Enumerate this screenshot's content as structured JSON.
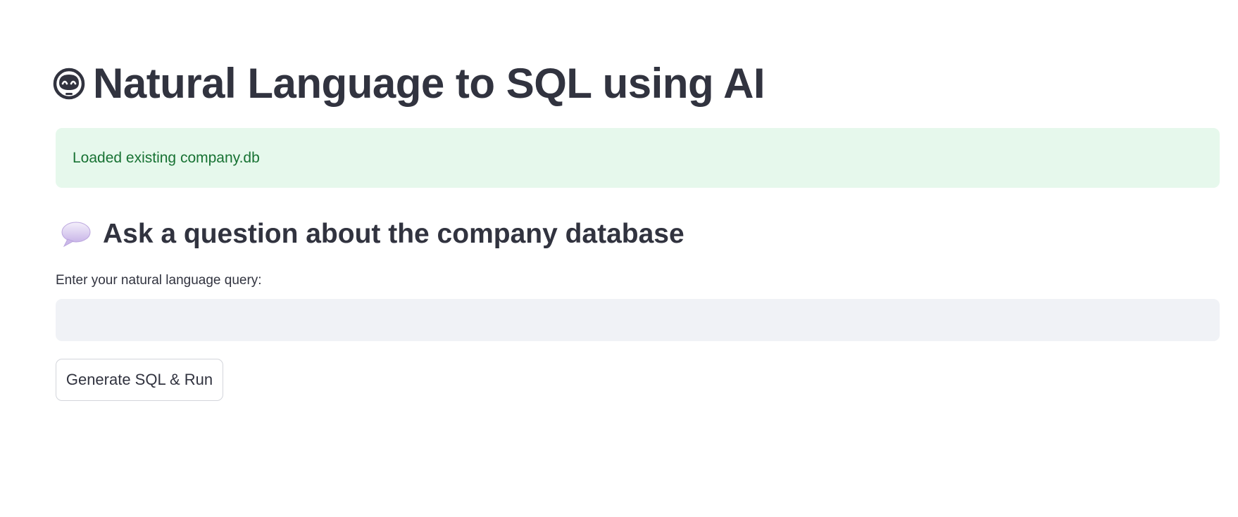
{
  "header": {
    "title": "Natural Language to SQL using AI",
    "icon": "robot-face-icon"
  },
  "alert": {
    "text": "Loaded existing company.db",
    "type": "success",
    "background": "#e6f8ec",
    "text_color": "#177233"
  },
  "section": {
    "subheader": "Ask a question about the company database",
    "icon": "speech-bubble-icon"
  },
  "query": {
    "label": "Enter your natural language query:",
    "value": "",
    "placeholder": ""
  },
  "actions": {
    "run_label": "Generate SQL & Run"
  },
  "colors": {
    "text": "#31333f",
    "input_background": "#f0f2f6"
  }
}
